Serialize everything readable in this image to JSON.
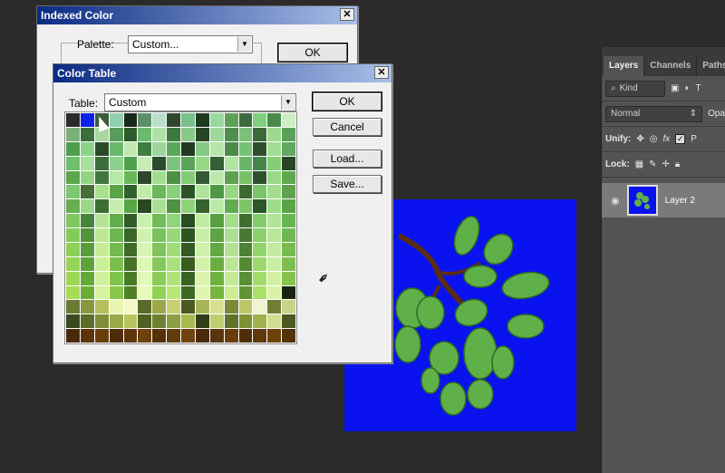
{
  "indexed_color": {
    "title": "Indexed Color",
    "close_label": "✕",
    "palette_label": "Palette:",
    "palette_value": "Custom...",
    "ok_label": "OK"
  },
  "color_table": {
    "title": "Color Table",
    "close_label": "✕",
    "table_label": "Table:",
    "table_value": "Custom",
    "buttons": {
      "ok": "OK",
      "cancel": "Cancel",
      "load": "Load...",
      "save": "Save..."
    }
  },
  "layers_panel": {
    "tabs": [
      "Layers",
      "Channels",
      "Paths"
    ],
    "kind_label": "Kind",
    "blend_mode": "Normal",
    "opacity_label": "Opa",
    "unify_label": "Unify:",
    "propagate_label": "P",
    "lock_label": "Lock:",
    "layer_name": "Layer 2"
  },
  "colors": {
    "canvas_bg": "#0a12f0",
    "swatches": [
      "#2b2b2b",
      "#1020e8",
      "#3c5a3c",
      "#8fd0b0",
      "#1a2a1a",
      "#5a8f6a",
      "#b8e0c8",
      "#2e4a2e",
      "#7ac08a",
      "#1e3a1e",
      "#9ad8a0",
      "#5ea05a",
      "#3d6a3d",
      "#7ecf7e",
      "#4a8a4a",
      "#c8f0c0",
      "#7ab07a",
      "#3c6e3c",
      "#a8d8a0",
      "#5a9a5a",
      "#2e5a2e",
      "#6cb86c",
      "#b0e0a8",
      "#3a7a3a",
      "#8ac88a",
      "#254525",
      "#9ed89e",
      "#4e8e4e",
      "#7cc07c",
      "#3a6a3a",
      "#a0d890",
      "#5aa05a",
      "#4e9e4e",
      "#8ad48a",
      "#2a4a2a",
      "#6ab86a",
      "#c0e8b0",
      "#3e7e3e",
      "#9cd49c",
      "#5aa85a",
      "#223a22",
      "#84c884",
      "#b8e4a8",
      "#4a8c4a",
      "#76c276",
      "#2e4e2e",
      "#a4dc94",
      "#62a862",
      "#6cc06c",
      "#a6e09a",
      "#3a6e3a",
      "#8ed08e",
      "#4ea04e",
      "#c4ecb4",
      "#2c4c2c",
      "#7cc47c",
      "#5aa45a",
      "#98d888",
      "#365e36",
      "#b2e4a2",
      "#6ab46a",
      "#44844a",
      "#88cc78",
      "#264626",
      "#5aa84a",
      "#92d482",
      "#3e783e",
      "#b6e8a6",
      "#68b858",
      "#2a482a",
      "#a2dc92",
      "#4c9044",
      "#84cc74",
      "#365a36",
      "#bce8ac",
      "#5ca24c",
      "#76c066",
      "#2e502e",
      "#98d888",
      "#60a850",
      "#7cc86c",
      "#486e3a",
      "#a8e090",
      "#5aa44a",
      "#34602e",
      "#c2ecaa",
      "#6cb85c",
      "#8ad07a",
      "#2e5228",
      "#b0e49c",
      "#4e9a44",
      "#98d884",
      "#3a6a30",
      "#7ac46a",
      "#a4dc8e",
      "#5ea24e",
      "#66b050",
      "#9ad886",
      "#3c6e32",
      "#c6ee b0",
      "#58a444",
      "#264a22",
      "#acdf96",
      "#4e9240",
      "#8ed47a",
      "#38622e",
      "#baea a4",
      "#62ac50",
      "#7cc468",
      "#2e5626",
      "#9edc88",
      "#5aa448",
      "#7ec860",
      "#4a8438",
      "#b4e49a",
      "#62ae4c",
      "#345c28",
      "#caf0b0",
      "#72bc5a",
      "#92d478",
      "#2a4e22",
      "#c0eaa4",
      "#56a040",
      "#a6dc88",
      "#3e6e30",
      "#84cc6a",
      "#b2e49a",
      "#6ab452",
      "#84cc58",
      "#52943a",
      "#bce896",
      "#6eb650",
      "#3a6628",
      "#d0f2b0",
      "#7ac25c",
      "#98d876",
      "#2e5420",
      "#c8ee a8",
      "#5ea440",
      "#ace090",
      "#467a34",
      "#8cd06c",
      "#bae69c",
      "#70b854",
      "#8cd05a",
      "#5a9c3c",
      "#c4ec98",
      "#74ba4e",
      "#3e6c28",
      "#d6f4b4",
      "#80c45a",
      "#a0dc78",
      "#325a22",
      "#cef0aa",
      "#64a842",
      "#b4e292",
      "#4c8236",
      "#94d46c",
      "#c2ea a0",
      "#76bc52",
      "#94d45a",
      "#60a23a",
      "#caee9a",
      "#7ac04c",
      "#447226",
      "#dcf6b6",
      "#86c858",
      "#a8e07a",
      "#365e22",
      "#d4f2ac",
      "#6aae40",
      "#bce694",
      "#528a34",
      "#9cd86a",
      "#caee a2",
      "#7ec050",
      "#9cd858",
      "#66a838",
      "#d0f09c",
      "#80c44a",
      "#4a7a26",
      "#e0f8b8",
      "#8ccc56",
      "#b0e478",
      "#3a6422",
      "#daf4ae",
      "#70b23e",
      "#c4ea94",
      "#589034",
      "#a4dc68",
      "#d2f0a4",
      "#84c44e",
      "#a4dc56",
      "#6cac36",
      "#d6f29e",
      "#86c848",
      "#508024",
      "#e6faba",
      "#92d054",
      "#b8e876",
      "#3e6a20",
      "#e0f6b0",
      "#76b63c",
      "#cced94",
      "#5e9632",
      "#acdf66",
      "#daf2a6",
      "#1a2410",
      "#6a7a30",
      "#8a9640",
      "#b4c060",
      "#e8f4b0",
      "#f4f8c8",
      "#5a6a28",
      "#9aa848",
      "#c6d070",
      "#4a5a20",
      "#a8b458",
      "#d8e090",
      "#7a8a38",
      "#bcc868",
      "#f0f4d0",
      "#6e7e34",
      "#c8d488",
      "#3a4a20",
      "#5a6e28",
      "#7e8e3a",
      "#9aaa4a",
      "#b8c460",
      "#4e6024",
      "#6e8030",
      "#8e9e42",
      "#aab852",
      "#2e3e18",
      "#c0cc70",
      "#5e7228",
      "#7e9034",
      "#a2b24a",
      "#d0dc90",
      "#4a5a22",
      "#4a2a08",
      "#5a3408",
      "#6a3e0c",
      "#4e2c0a",
      "#5e360a",
      "#6e400e",
      "#52300a",
      "#623a0c",
      "#72420e",
      "#4a2c0a",
      "#5a340c",
      "#6a3c0e",
      "#4e2e0a",
      "#5e380c",
      "#6e420e",
      "#563208"
    ]
  }
}
